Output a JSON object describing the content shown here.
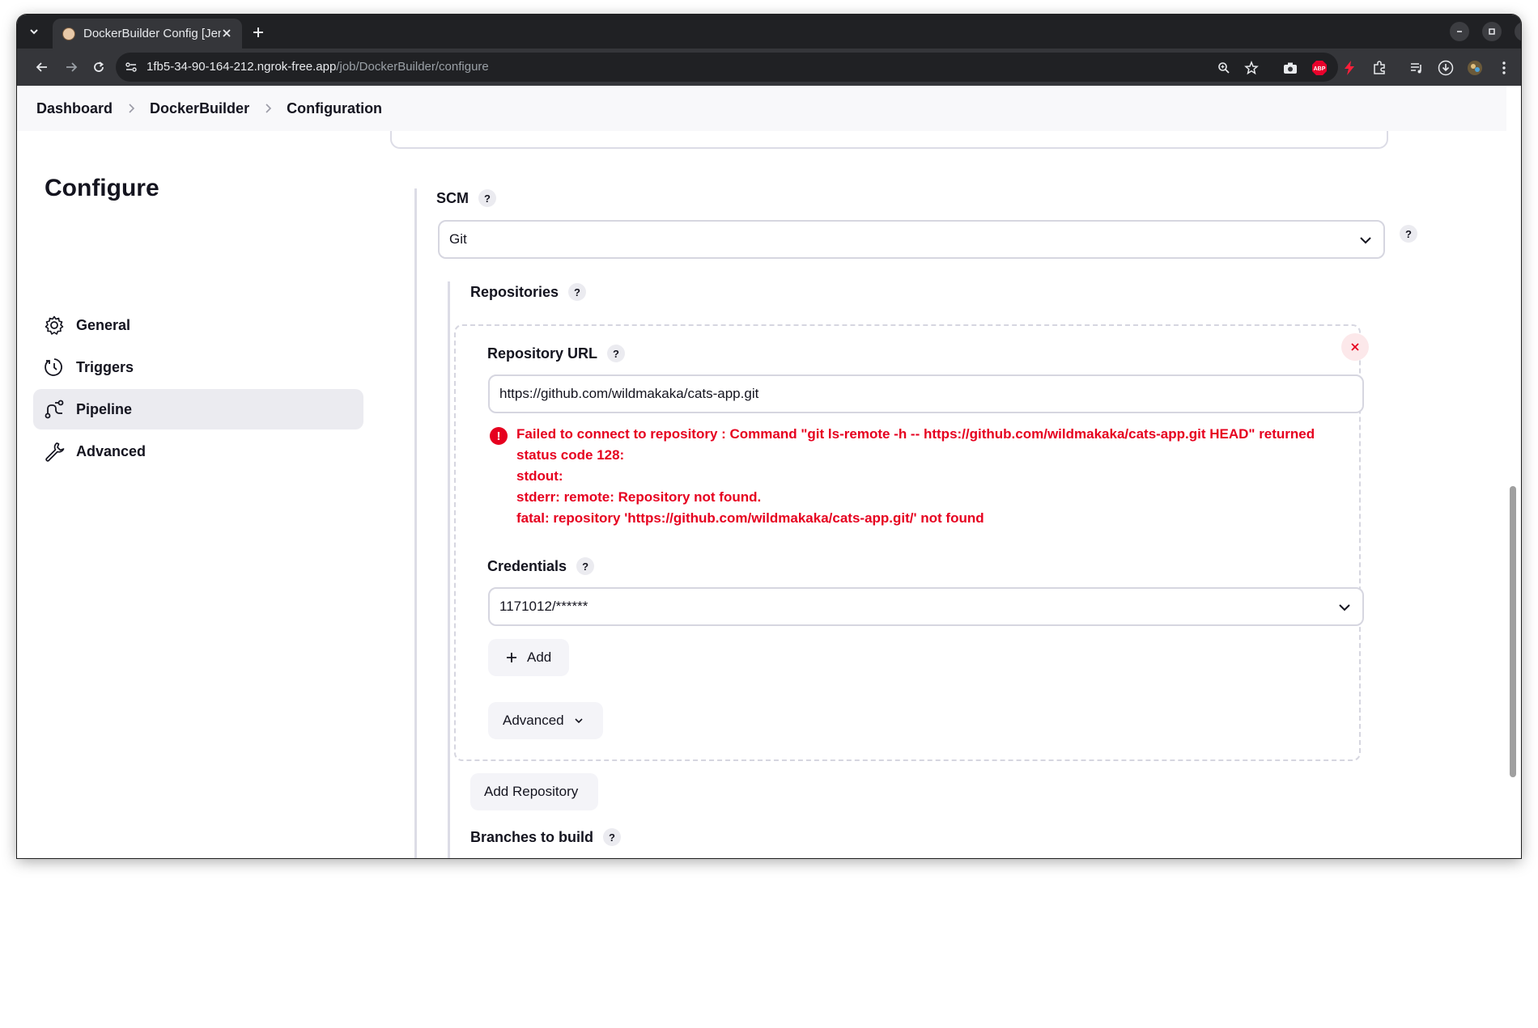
{
  "browser": {
    "tab_title": "DockerBuilder Config [Jenkins]",
    "url_host": "1fb5-34-90-164-212.ngrok-free.app",
    "url_path": "/job/DockerBuilder/configure",
    "extensions": [
      "screenshot-icon",
      "adblock-icon",
      "bolt-extension-icon",
      "puzzle-icon",
      "media-icon",
      "download-icon",
      "profile-icon"
    ]
  },
  "breadcrumb": {
    "items": [
      "Dashboard",
      "DockerBuilder",
      "Configuration"
    ]
  },
  "sidebar": {
    "title": "Configure",
    "items": [
      {
        "label": "General",
        "icon": "gear-icon"
      },
      {
        "label": "Triggers",
        "icon": "clock-icon"
      },
      {
        "label": "Pipeline",
        "icon": "pipeline-icon"
      },
      {
        "label": "Advanced",
        "icon": "wrench-icon"
      }
    ],
    "active": "Pipeline"
  },
  "scm": {
    "label": "SCM",
    "help": "?",
    "selected": "Git"
  },
  "repositories": {
    "label": "Repositories",
    "help": "?",
    "repository_url_label": "Repository URL",
    "repository_url_value": "https://github.com/wildmakaka/cats-app.git",
    "error_icon": "!",
    "error_lines": [
      "Failed to connect to repository : Command \"git ls-remote -h -- https://github.com/wildmakaka/cats-app.git HEAD\" returned",
      "status code 128:",
      "stdout:",
      "stderr: remote: Repository not found.",
      "fatal: repository 'https://github.com/wildmakaka/cats-app.git/' not found"
    ],
    "credentials_label": "Credentials",
    "credentials_value": "1171012/******",
    "add_label": "Add",
    "advanced_label": "Advanced",
    "add_repository_label": "Add Repository"
  },
  "branches": {
    "label": "Branches to build",
    "help": "?"
  },
  "colors": {
    "error": "#e6001f",
    "sidebar_active_bg": "#ebebf0",
    "border": "#d6d6e0"
  }
}
